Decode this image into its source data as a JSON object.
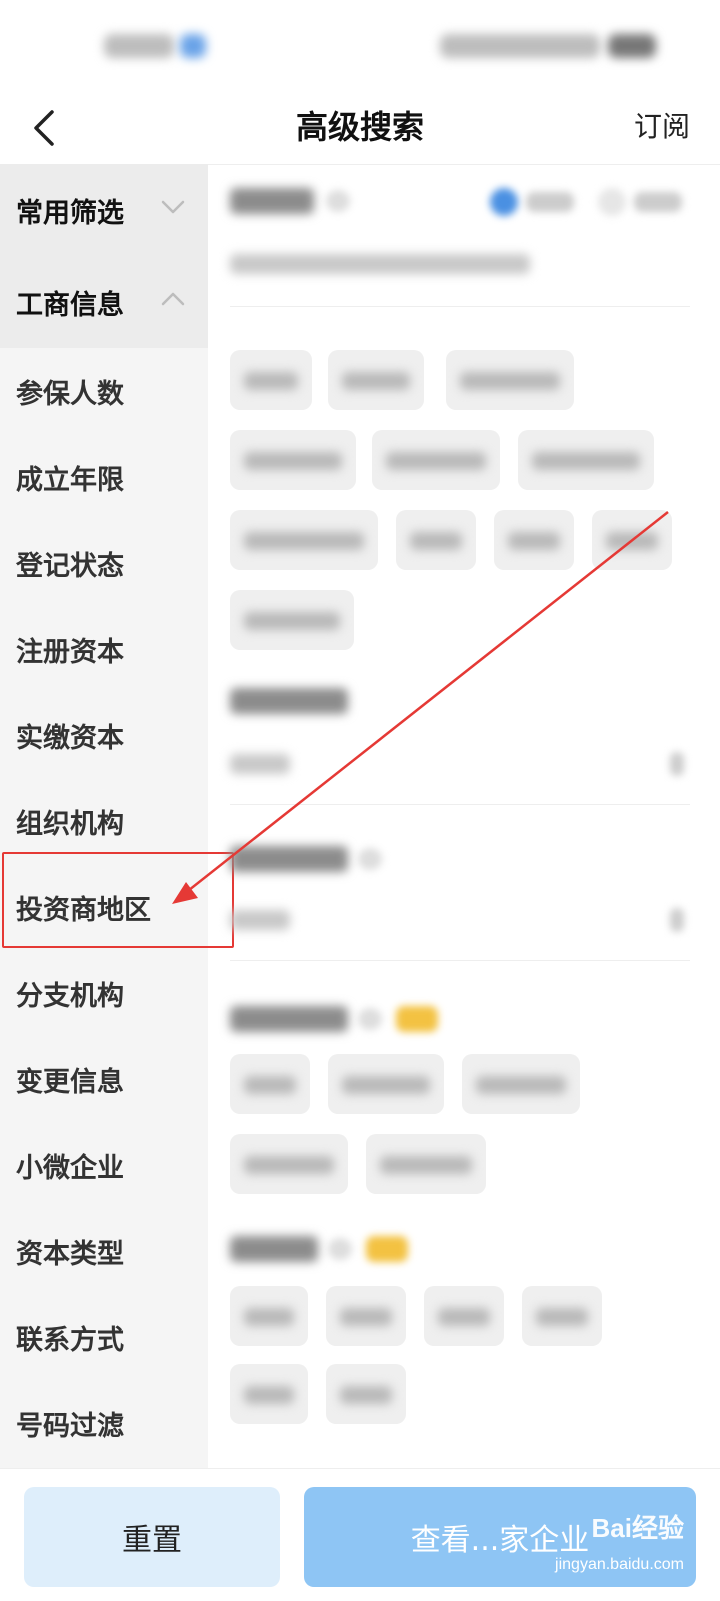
{
  "header": {
    "title": "高级搜索",
    "subscribe_label": "订阅"
  },
  "sidebar": {
    "groups": [
      {
        "label": "常用筛选",
        "expanded": false
      },
      {
        "label": "工商信息",
        "expanded": true
      }
    ],
    "items": [
      {
        "label": "参保人数"
      },
      {
        "label": "成立年限"
      },
      {
        "label": "登记状态"
      },
      {
        "label": "注册资本"
      },
      {
        "label": "实缴资本"
      },
      {
        "label": "组织机构"
      },
      {
        "label": "投资商地区",
        "highlighted": true
      },
      {
        "label": "分支机构"
      },
      {
        "label": "变更信息"
      },
      {
        "label": "小微企业"
      },
      {
        "label": "资本类型"
      },
      {
        "label": "联系方式"
      },
      {
        "label": "号码过滤"
      }
    ]
  },
  "footer": {
    "reset_label": "重置",
    "view_label": "查看...家企业"
  },
  "watermark": {
    "brand": "Bai经验",
    "url": "jingyan.baidu.com"
  },
  "colors": {
    "accent": "#8ec5f4",
    "reset_bg": "#deeefb",
    "highlight": "#e53935",
    "sidebar_bg": "#f5f5f5",
    "group_bg": "#ececec"
  }
}
